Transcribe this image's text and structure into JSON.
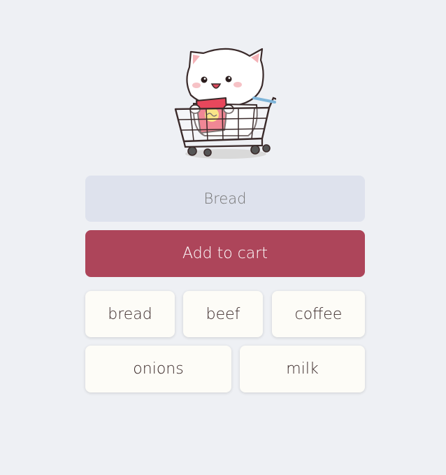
{
  "mascot": {
    "icon": "cat-in-shopping-cart-icon"
  },
  "search": {
    "placeholder": "Bread",
    "value": ""
  },
  "add_button": {
    "label": "Add to cart",
    "color": "#ad455a"
  },
  "items": [
    {
      "label": "bread"
    },
    {
      "label": "beef"
    },
    {
      "label": "coffee"
    },
    {
      "label": "onions"
    },
    {
      "label": "milk"
    }
  ],
  "colors": {
    "background": "#eef0f4",
    "input_bg": "#dee2ed",
    "item_bg": "#fdfcf7"
  }
}
